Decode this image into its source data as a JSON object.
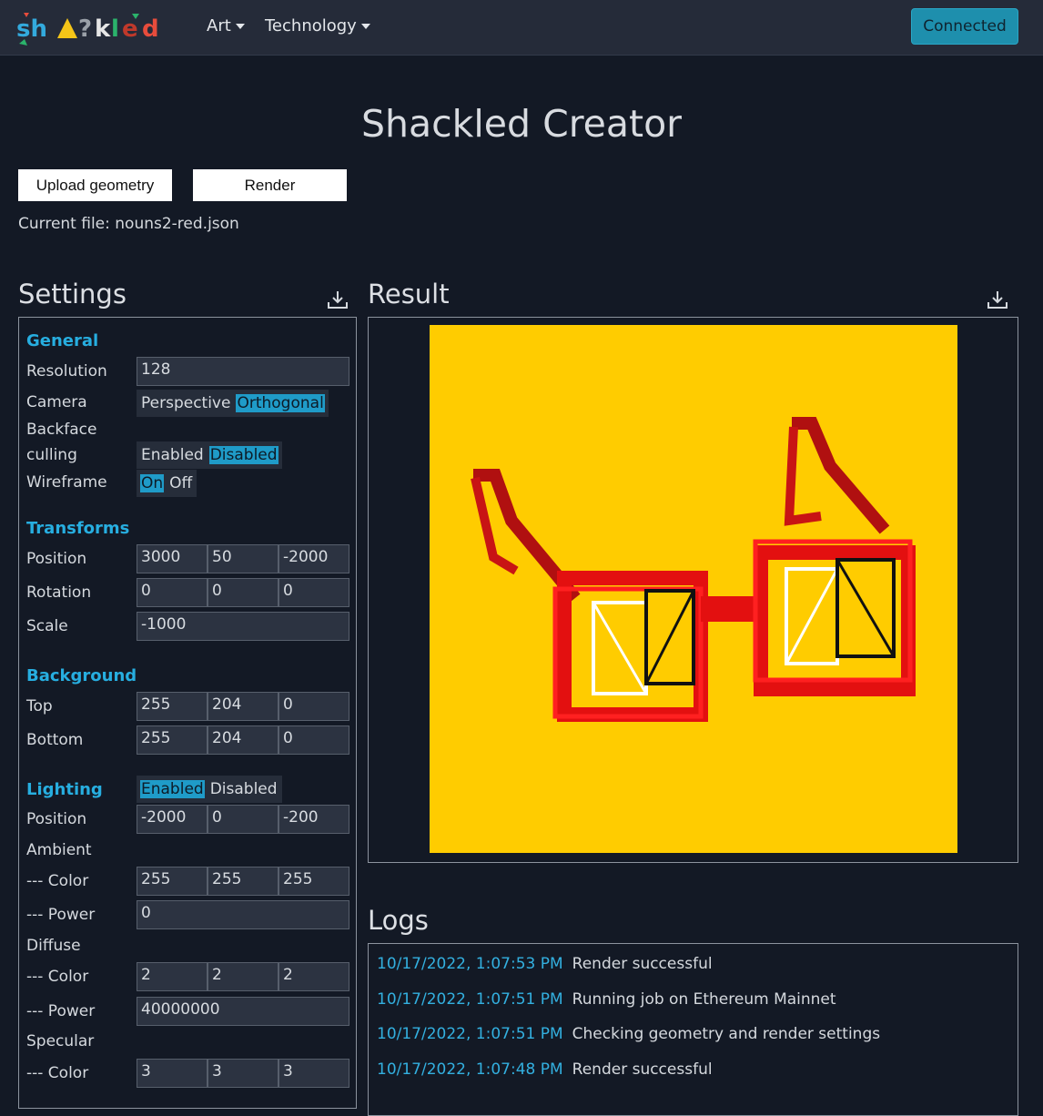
{
  "nav": {
    "brand": "shackled",
    "menu": [
      {
        "label": "Art"
      },
      {
        "label": "Technology"
      }
    ],
    "status_button": "Connected"
  },
  "page_title": "Shackled Creator",
  "toolbar": {
    "upload_label": "Upload geometry",
    "render_label": "Render",
    "current_file_label": "Current file: nouns2-red.json"
  },
  "settings": {
    "title": "Settings",
    "general": {
      "heading": "General",
      "resolution_label": "Resolution",
      "resolution": "128",
      "camera_label": "Camera",
      "camera_options": [
        "Perspective",
        "Orthogonal"
      ],
      "camera_selected": "Orthogonal",
      "backface_label_1": "Backface",
      "backface_label_2": "culling",
      "backface_options": [
        "Enabled",
        "Disabled"
      ],
      "backface_selected": "Disabled",
      "wireframe_label": "Wireframe",
      "wireframe_options": [
        "On",
        "Off"
      ],
      "wireframe_selected": "On"
    },
    "transforms": {
      "heading": "Transforms",
      "position_label": "Position",
      "position": [
        "3000",
        "50",
        "-2000"
      ],
      "rotation_label": "Rotation",
      "rotation": [
        "0",
        "0",
        "0"
      ],
      "scale_label": "Scale",
      "scale": "-1000"
    },
    "background": {
      "heading": "Background",
      "top_label": "Top",
      "top": [
        "255",
        "204",
        "0"
      ],
      "bottom_label": "Bottom",
      "bottom": [
        "255",
        "204",
        "0"
      ]
    },
    "lighting": {
      "heading": "Lighting",
      "options": [
        "Enabled",
        "Disabled"
      ],
      "selected": "Enabled",
      "position_label": "Position",
      "position": [
        "-2000",
        "0",
        "-200"
      ],
      "ambient_label": "Ambient",
      "ambient_color_label": "--- Color",
      "ambient_color": [
        "255",
        "255",
        "255"
      ],
      "ambient_power_label": "--- Power",
      "ambient_power": "0",
      "diffuse_label": "Diffuse",
      "diffuse_color_label": "--- Color",
      "diffuse_color": [
        "2",
        "2",
        "2"
      ],
      "diffuse_power_label": "--- Power",
      "diffuse_power": "40000000",
      "specular_label": "Specular",
      "specular_color_label": "--- Color",
      "specular_color": [
        "3",
        "3",
        "3"
      ]
    }
  },
  "result": {
    "title": "Result",
    "background_color": "#ffcc00"
  },
  "logs": {
    "title": "Logs",
    "entries": [
      {
        "time": "10/17/2022, 1:07:53 PM",
        "message": "Render successful"
      },
      {
        "time": "10/17/2022, 1:07:51 PM",
        "message": "Running job on Ethereum Mainnet"
      },
      {
        "time": "10/17/2022, 1:07:51 PM",
        "message": "Checking geometry and render settings"
      },
      {
        "time": "10/17/2022, 1:07:48 PM",
        "message": "Render successful"
      }
    ]
  },
  "colors": {
    "accent": "#27aee0",
    "button_connected": "#1e8fad",
    "background": "#131925",
    "navbar": "#252b39"
  },
  "icons": {
    "download": "download-icon",
    "caret": "caret-down-icon"
  }
}
